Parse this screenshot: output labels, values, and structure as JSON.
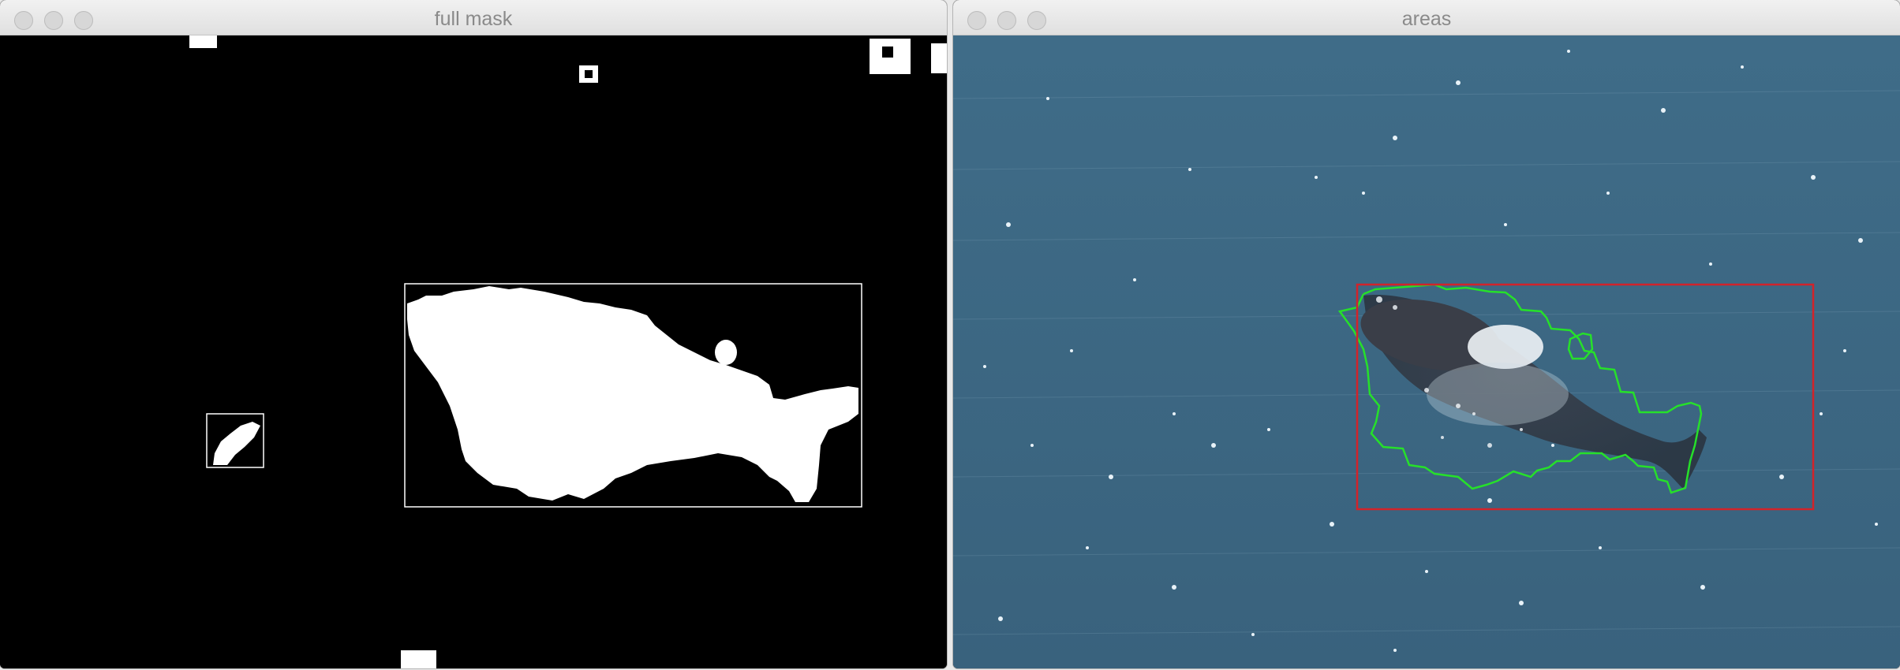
{
  "windows": {
    "left": {
      "title": "full mask"
    },
    "right": {
      "title": "areas"
    }
  },
  "colors": {
    "mask_fg": "#ffffff",
    "mask_bg": "#000000",
    "bbox_red": "#d2232a",
    "contour_green": "#26e02a",
    "sea": "#3d6a86"
  }
}
